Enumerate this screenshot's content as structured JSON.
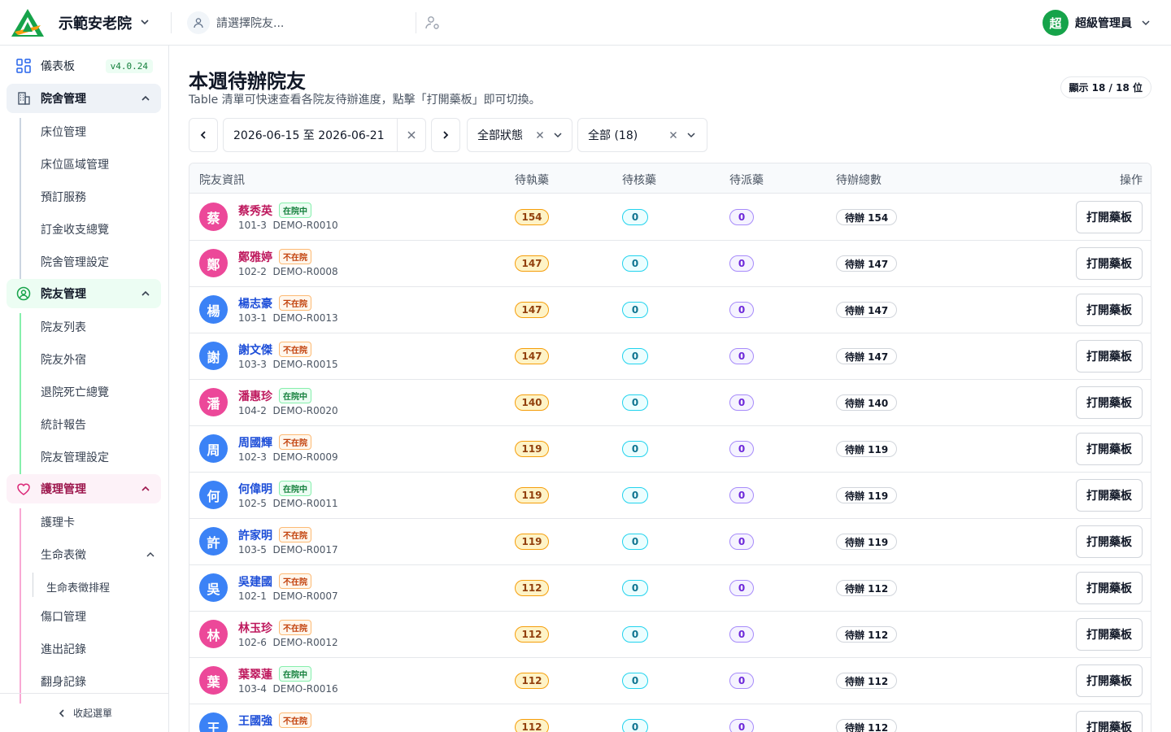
{
  "app": {
    "org_name": "示範安老院",
    "resident_placeholder": "請選擇院友...",
    "user_initial": "超",
    "user_name": "超級管理員",
    "accent": "#16a34a"
  },
  "sidebar": {
    "dashboard": "儀表板",
    "version": "v4.0.24",
    "groups": [
      {
        "label": "院舍管理",
        "items": [
          "床位管理",
          "床位區域管理",
          "預訂服務",
          "訂金收支總覽",
          "院舍管理設定"
        ]
      },
      {
        "label": "院友管理",
        "items": [
          "院友列表",
          "院友外宿",
          "退院死亡總覽",
          "統計報告",
          "院友管理設定"
        ]
      },
      {
        "label": "護理管理",
        "items": [
          "護理卡",
          "生命表徵",
          "生命表徵排程",
          "傷口管理",
          "進出記錄",
          "翻身記錄"
        ]
      }
    ],
    "collapse": "收起選單"
  },
  "main": {
    "title": "本週待辦院友",
    "subtitle": "Table 清單可快速查看各院友待辦進度，點擊「打開藥板」即可切換。",
    "count_badge": "顯示 18 / 18 位",
    "date_range": "2026-06-15 至 2026-06-21",
    "status_filter": "全部狀態",
    "group_filter": "全部 (18)"
  },
  "table": {
    "columns": [
      "院友資訊",
      "待執藥",
      "待核藥",
      "待派藥",
      "待辦總數",
      "操作"
    ],
    "action_label": "打開藥板",
    "rows": [
      {
        "initial": "蔡",
        "name": "蔡秀英",
        "gender": "f",
        "status": "在院中",
        "bed": "101-3",
        "code": "DEMO-R0010",
        "exec": "154",
        "check": "0",
        "dispatch": "0",
        "total": "待辦 154"
      },
      {
        "initial": "鄭",
        "name": "鄭雅婷",
        "gender": "f",
        "status": "不在院",
        "bed": "102-2",
        "code": "DEMO-R0008",
        "exec": "147",
        "check": "0",
        "dispatch": "0",
        "total": "待辦 147"
      },
      {
        "initial": "楊",
        "name": "楊志豪",
        "gender": "m",
        "status": "不在院",
        "bed": "103-1",
        "code": "DEMO-R0013",
        "exec": "147",
        "check": "0",
        "dispatch": "0",
        "total": "待辦 147"
      },
      {
        "initial": "謝",
        "name": "謝文傑",
        "gender": "m",
        "status": "不在院",
        "bed": "103-3",
        "code": "DEMO-R0015",
        "exec": "147",
        "check": "0",
        "dispatch": "0",
        "total": "待辦 147"
      },
      {
        "initial": "潘",
        "name": "潘惠珍",
        "gender": "f",
        "status": "在院中",
        "bed": "104-2",
        "code": "DEMO-R0020",
        "exec": "140",
        "check": "0",
        "dispatch": "0",
        "total": "待辦 140"
      },
      {
        "initial": "周",
        "name": "周國輝",
        "gender": "m",
        "status": "不在院",
        "bed": "102-3",
        "code": "DEMO-R0009",
        "exec": "119",
        "check": "0",
        "dispatch": "0",
        "total": "待辦 119"
      },
      {
        "initial": "何",
        "name": "何偉明",
        "gender": "m",
        "status": "在院中",
        "bed": "102-5",
        "code": "DEMO-R0011",
        "exec": "119",
        "check": "0",
        "dispatch": "0",
        "total": "待辦 119"
      },
      {
        "initial": "許",
        "name": "許家明",
        "gender": "m",
        "status": "不在院",
        "bed": "103-5",
        "code": "DEMO-R0017",
        "exec": "119",
        "check": "0",
        "dispatch": "0",
        "total": "待辦 119"
      },
      {
        "initial": "吳",
        "name": "吳建國",
        "gender": "m",
        "status": "不在院",
        "bed": "102-1",
        "code": "DEMO-R0007",
        "exec": "112",
        "check": "0",
        "dispatch": "0",
        "total": "待辦 112"
      },
      {
        "initial": "林",
        "name": "林玉珍",
        "gender": "f",
        "status": "不在院",
        "bed": "102-6",
        "code": "DEMO-R0012",
        "exec": "112",
        "check": "0",
        "dispatch": "0",
        "total": "待辦 112"
      },
      {
        "initial": "葉",
        "name": "葉翠蓮",
        "gender": "f",
        "status": "在院中",
        "bed": "103-4",
        "code": "DEMO-R0016",
        "exec": "112",
        "check": "0",
        "dispatch": "0",
        "total": "待辦 112"
      },
      {
        "initial": "王",
        "name": "王國強",
        "gender": "m",
        "status": "不在院",
        "bed": "",
        "code": "",
        "exec": "112",
        "check": "0",
        "dispatch": "0",
        "total": "待辦 112"
      }
    ]
  },
  "colors": {
    "female": "#ec4899",
    "male": "#3b82f6",
    "female_text": "#be185d",
    "male_text": "#1d4ed8"
  }
}
